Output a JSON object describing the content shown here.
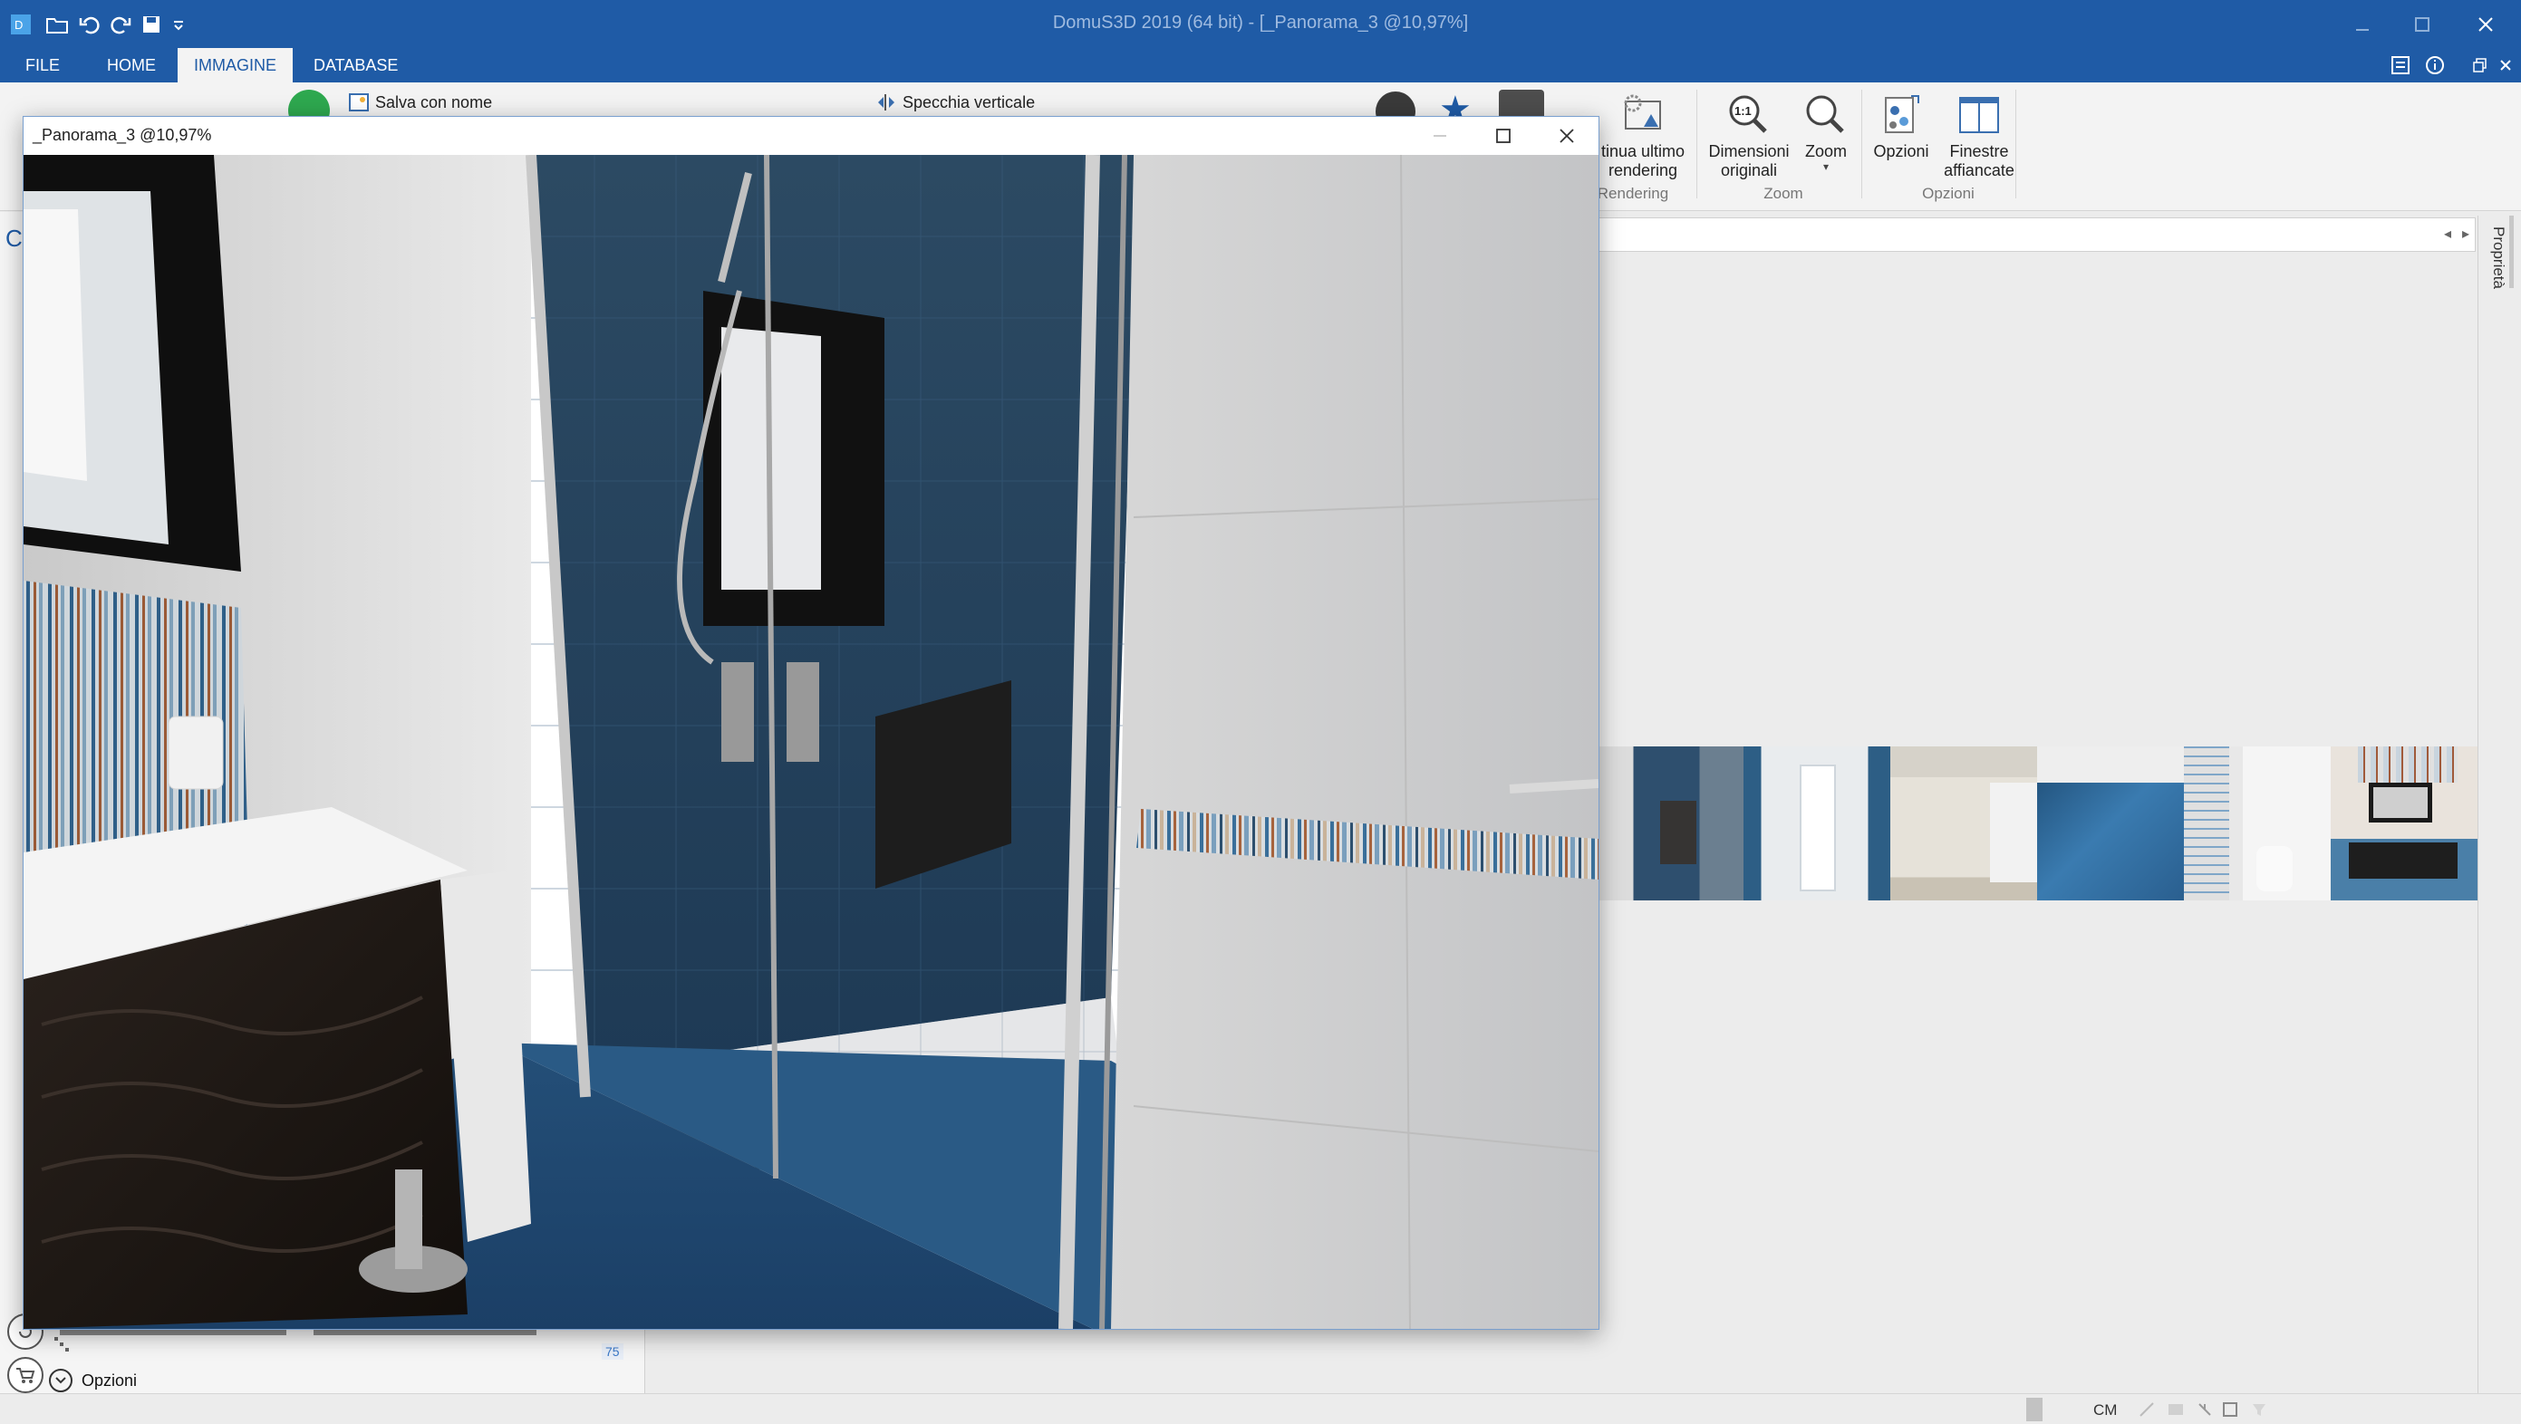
{
  "app": {
    "title": "DomuS3D 2019 (64 bit) - [_Panorama_3 @10,97%]",
    "accent": "#1f5ba6"
  },
  "menu_tabs": [
    {
      "label": "FILE",
      "active": false
    },
    {
      "label": "HOME",
      "active": false
    },
    {
      "label": "IMMAGINE",
      "active": true
    },
    {
      "label": "DATABASE",
      "active": false
    }
  ],
  "ribbon": {
    "save_as_label": "Salva con nome",
    "mirror_vertical_label": "Specchia verticale",
    "repeat_last_rendering_label": "tinua ultimo\nrendering",
    "original_size_label": "Dimensioni\noriginali",
    "zoom_label": "Zoom",
    "options_label": "Opzioni",
    "tiled_windows_label": "Finestre\naffiancate",
    "groups": {
      "rendering": "Rendering",
      "zoom": "Zoom",
      "options": "Opzioni"
    }
  },
  "image_window": {
    "title": "_Panorama_3 @10,97%"
  },
  "properties_panel": {
    "label": "Proprietà"
  },
  "left_panel": {
    "edge_char": "C",
    "badge_value": "75",
    "options_label": "Opzioni"
  },
  "statusbar": {
    "unit": "CM"
  },
  "thumbnails": [
    {
      "name": "shower-view",
      "colors": [
        "#2e4f6e",
        "#6b7f90",
        "#d8d8d8"
      ]
    },
    {
      "name": "doorway-view",
      "colors": [
        "#e9ecee",
        "#ffffff",
        "#2d5e85"
      ]
    },
    {
      "name": "cabinet-view",
      "colors": [
        "#e6e2d9",
        "#c9c2b4",
        "#2f6a8f"
      ]
    },
    {
      "name": "floor-view",
      "colors": [
        "#2a5f8f",
        "#3a7bb0",
        "#1d4a72"
      ]
    },
    {
      "name": "toilet-view",
      "colors": [
        "#dcdcdc",
        "#f3f3f3",
        "#7fa6c8"
      ]
    },
    {
      "name": "vanity-view",
      "colors": [
        "#e9e3dc",
        "#1e1e1e",
        "#4a7fa8"
      ]
    }
  ]
}
